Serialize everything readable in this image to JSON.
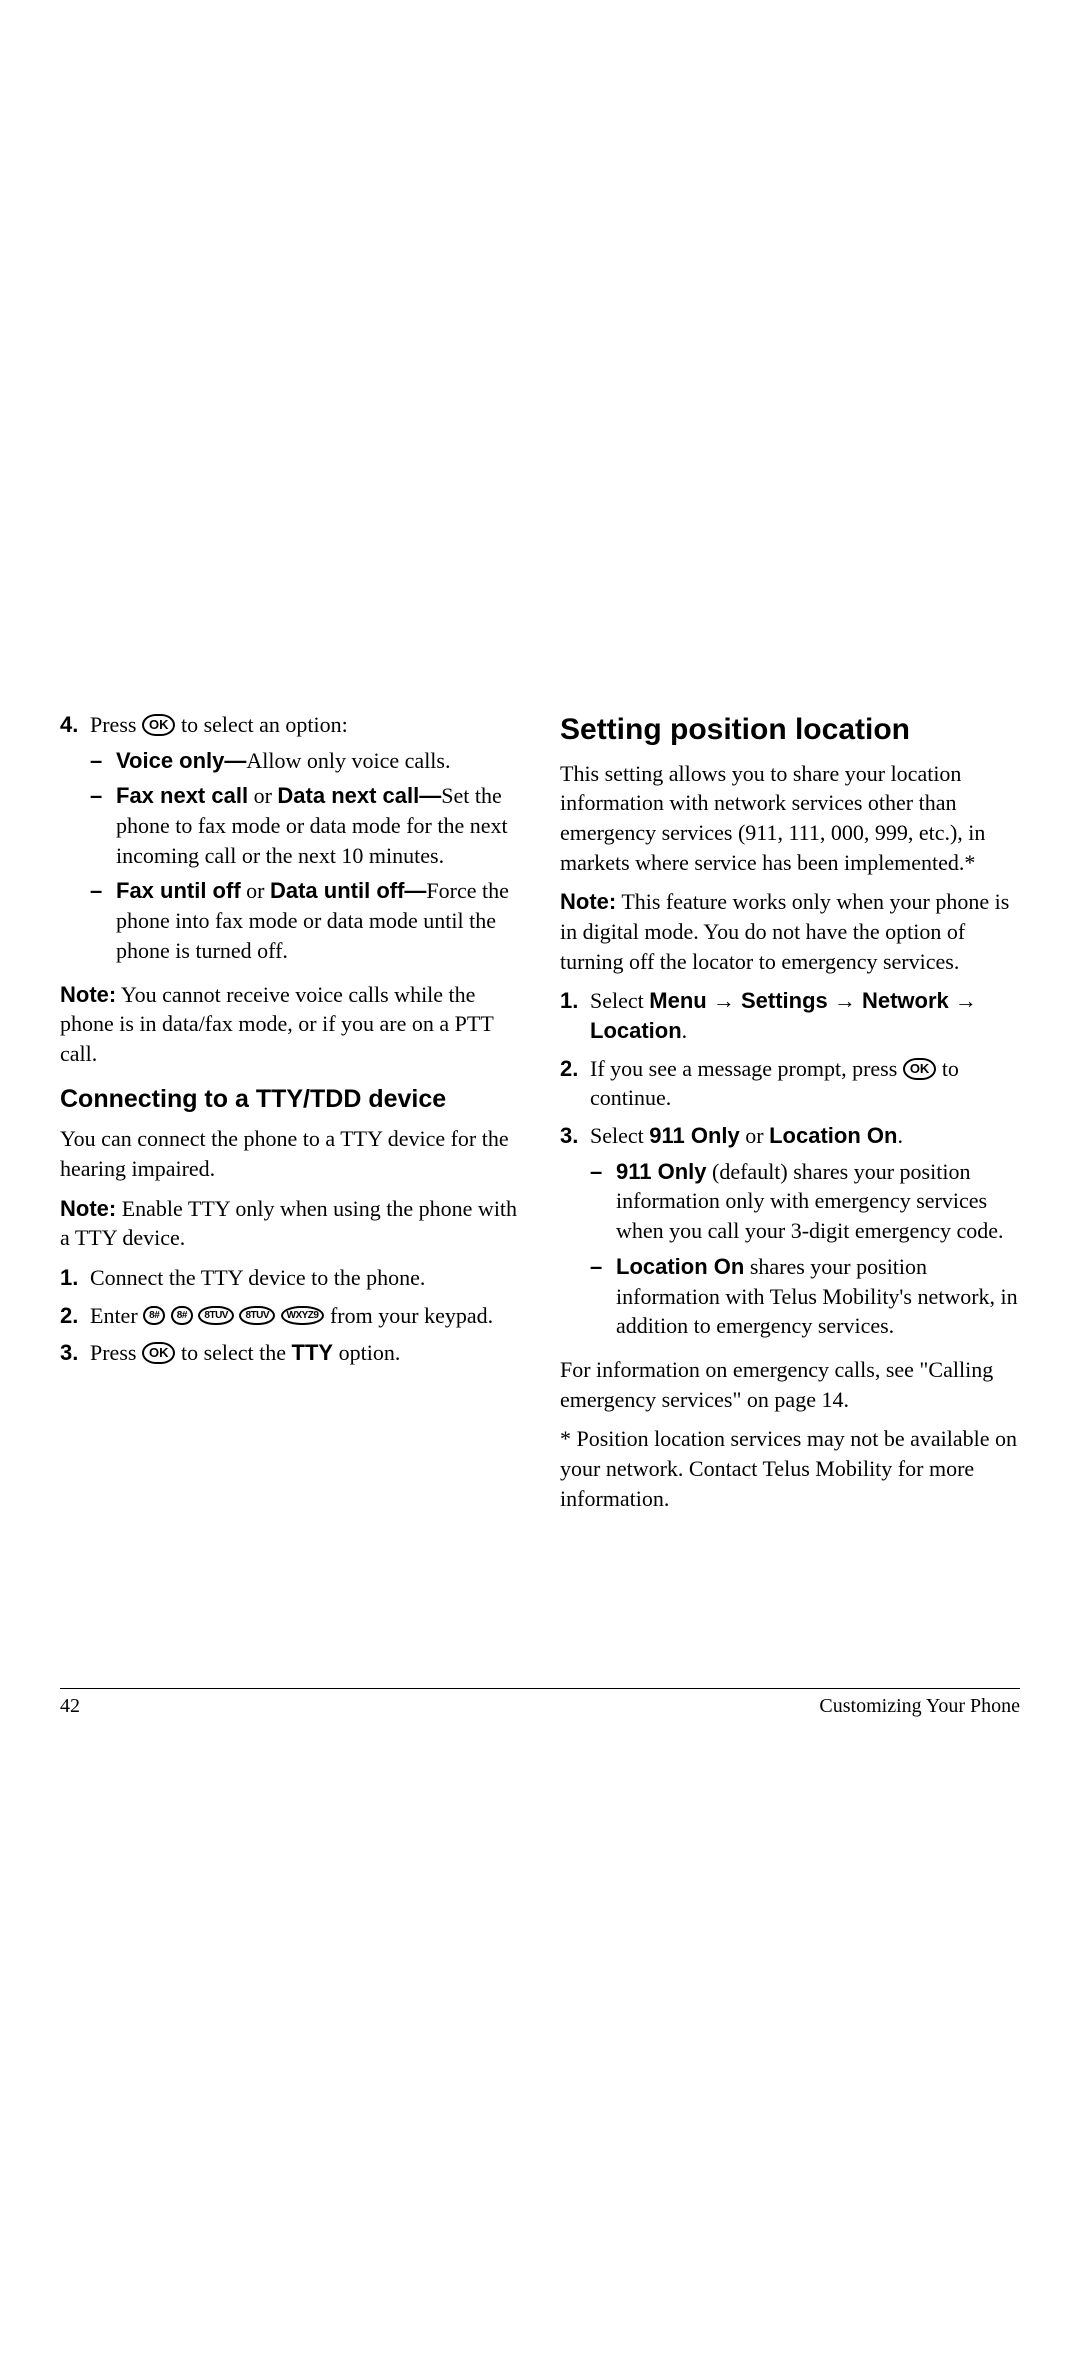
{
  "left": {
    "step4_marker": "4.",
    "step4_a": "Press ",
    "step4_b": " to select an option:",
    "vo_bold": "Voice only—",
    "vo_rest": "Allow only voice calls.",
    "fnc_bold1": "Fax next call",
    "fnc_or": " or ",
    "fnc_bold2": "Data next call—",
    "fnc_rest": "Set the phone to fax mode or data mode for the next incoming call or the next 10 minutes.",
    "fuo_bold1": "Fax until off",
    "fuo_or": " or ",
    "fuo_bold2": "Data until off—",
    "fuo_rest": "Force the phone into fax mode or data mode until the phone is turned off.",
    "note1_label": "Note:",
    "note1_body": "  You cannot receive voice calls while the phone is in data/fax mode, or if you are on a PTT call.",
    "h2": "Connecting to a TTY/TDD device",
    "p1": "You can connect the phone to a TTY device for the hearing impaired.",
    "note2_label": "Note:",
    "note2_body": "  Enable TTY only when using the phone with a TTY device.",
    "s1_marker": "1.",
    "s1": "Connect the TTY device to the phone.",
    "s2_marker": "2.",
    "s2a": "Enter ",
    "s2b": " from your keypad.",
    "s3_marker": "3.",
    "s3a": "Press ",
    "s3b": " to select the ",
    "s3_tty": "TTY",
    "s3c": " option.",
    "ok": "OK",
    "k1": "8#",
    "k2": "8#",
    "k3": "8TUV",
    "k4": "8TUV",
    "k5": "WXYZ9"
  },
  "right": {
    "h1": "Setting position location",
    "p1": "This setting allows you to share your location information with network services other than emergency services (911, 111, 000, 999, etc.), in markets where service has been implemented.*",
    "note_label": "Note:",
    "note_body": "  This feature works only when your phone is in digital mode. You do not have the option of turning off the locator to emergency services.",
    "s1_marker": "1.",
    "s1a": "Select ",
    "s1_menu": "Menu",
    "s1_settings": "Settings",
    "s1_network": "Network",
    "s1_location": "Location",
    "arrow": " → ",
    "period": ".",
    "s2_marker": "2.",
    "s2a": "If you see a message prompt, press ",
    "s2b": " to continue.",
    "s3_marker": "3.",
    "s3a": "Select ",
    "s3_911": "911 Only",
    "s3_or": " or ",
    "s3_loc": "Location On",
    "d1_bold": "911 Only",
    "d1_rest": " (default) shares your position information only with emergency services when you call your 3-digit emergency code.",
    "d2_bold": "Location On",
    "d2_rest": " shares your position information with Telus Mobility's network, in addition to emergency services.",
    "p2": "For information on emergency calls, see \"Calling emergency services\" on page 14.",
    "p3": "* Position location services may not be available on your network. Contact Telus Mobility for more information.",
    "ok": "OK"
  },
  "footer": {
    "page": "42",
    "chapter": "Customizing Your Phone"
  }
}
